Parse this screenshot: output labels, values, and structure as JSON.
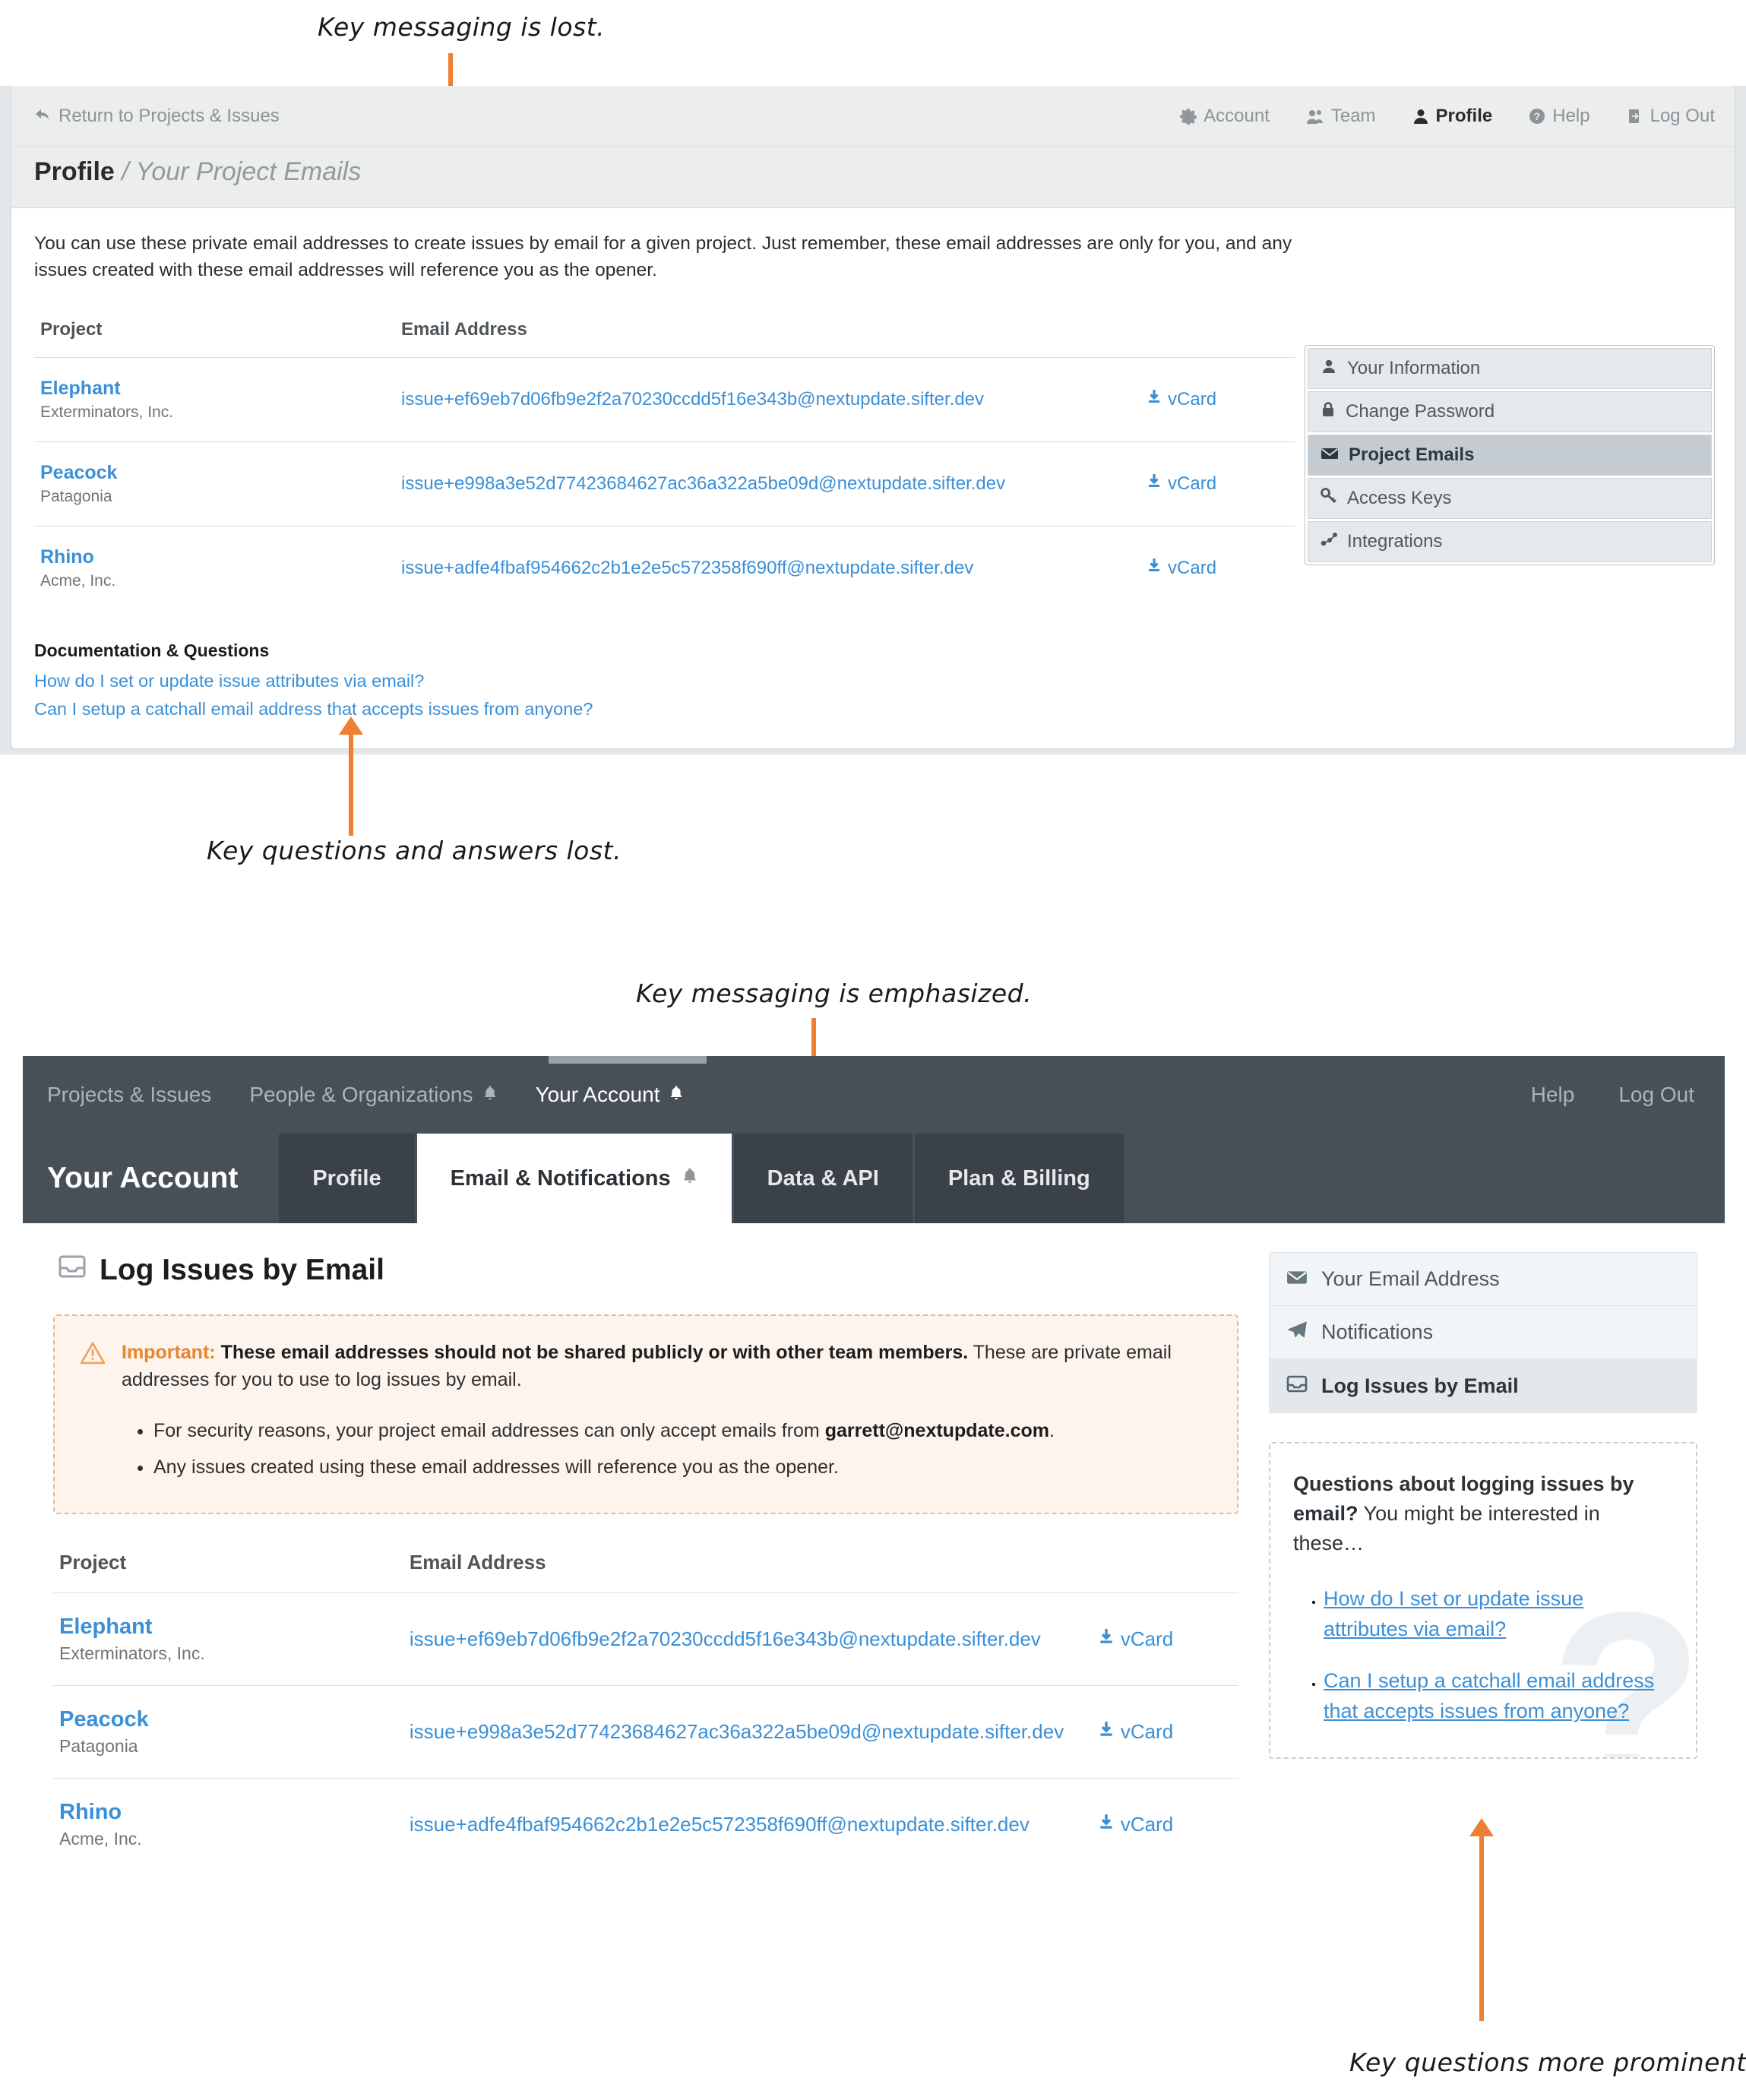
{
  "annotations": [
    {
      "id": "a1",
      "text": "Key messaging is lost."
    },
    {
      "id": "a2",
      "text": "Key questions and answers lost."
    },
    {
      "id": "a3",
      "text": "Key messaging is emphasized."
    },
    {
      "id": "a4",
      "text": "Key questions more prominent."
    }
  ],
  "colors": {
    "accent_orange": "#ef7f33",
    "link_blue": "#3b8fd6",
    "dark_nav": "#474f57",
    "warning_orange": "#e8842c"
  },
  "old_design": {
    "return_link": "Return to Projects & Issues",
    "nav": [
      {
        "label": "Account",
        "icon": "gear-icon",
        "active": false
      },
      {
        "label": "Team",
        "icon": "people-icon",
        "active": false
      },
      {
        "label": "Profile",
        "icon": "person-icon",
        "active": true
      },
      {
        "label": "Help",
        "icon": "question-circle-icon",
        "active": false
      },
      {
        "label": "Log Out",
        "icon": "logout-icon",
        "active": false
      }
    ],
    "title_main": "Profile",
    "title_sep": " / ",
    "title_sub": "Your Project Emails",
    "intro": "You can use these private email addresses to create issues by email for a given project. Just remember, these email addresses are only for you, and any issues created with these email addresses will reference you as the opener.",
    "table": {
      "headers": [
        "Project",
        "Email Address"
      ],
      "vcard_label": "vCard",
      "rows": [
        {
          "project": "Elephant",
          "org": "Exterminators, Inc.",
          "email": "issue+ef69eb7d06fb9e2f2a70230ccdd5f16e343b@nextupdate.sifter.dev"
        },
        {
          "project": "Peacock",
          "org": "Patagonia",
          "email": "issue+e998a3e52d77423684627ac36a322a5be09d@nextupdate.sifter.dev"
        },
        {
          "project": "Rhino",
          "org": "Acme, Inc.",
          "email": "issue+adfe4fbaf954662c2b1e2e5c572358f690ff@nextupdate.sifter.dev"
        }
      ]
    },
    "docs": {
      "heading": "Documentation & Questions",
      "links": [
        "How do I set or update issue attributes via email?",
        "Can I setup a catchall email address that accepts issues from anyone?"
      ]
    },
    "sidebar": [
      {
        "label": "Your Information",
        "icon": "person-icon",
        "active": false
      },
      {
        "label": "Change Password",
        "icon": "lock-icon",
        "active": false
      },
      {
        "label": "Project Emails",
        "icon": "envelope-icon",
        "active": true
      },
      {
        "label": "Access Keys",
        "icon": "key-icon",
        "active": false
      },
      {
        "label": "Integrations",
        "icon": "share-nodes-icon",
        "active": false
      }
    ]
  },
  "new_design": {
    "topnav_left": [
      {
        "label": "Projects & Issues",
        "bell": false,
        "active": false
      },
      {
        "label": "People & Organizations",
        "bell": true,
        "active": false
      },
      {
        "label": "Your Account",
        "bell": true,
        "active": true
      }
    ],
    "topnav_right": [
      {
        "label": "Help"
      },
      {
        "label": "Log Out"
      }
    ],
    "account_title": "Your Account",
    "tabs": [
      {
        "label": "Profile",
        "bell": false,
        "active": false
      },
      {
        "label": "Email & Notifications",
        "bell": true,
        "active": true
      },
      {
        "label": "Data & API",
        "bell": false,
        "active": false
      },
      {
        "label": "Plan & Billing",
        "bell": false,
        "active": false
      }
    ],
    "page_title": "Log Issues by Email",
    "page_title_icon": "inbox-icon",
    "important": {
      "icon": "warning-triangle-icon",
      "label": "Important:",
      "bold_part": "These email addresses should not be shared publicly or with other team members.",
      "rest": " These are private email addresses for you to use to log issues by email.",
      "bullets": [
        {
          "pre": "For security reasons, your project email addresses can only accept emails from ",
          "bold": "garrett@nextupdate.com",
          "post": "."
        },
        {
          "pre": "Any issues created using these email addresses will reference you as the opener.",
          "bold": "",
          "post": ""
        }
      ]
    },
    "table": {
      "headers": [
        "Project",
        "Email Address"
      ],
      "vcard_label": "vCard",
      "rows": [
        {
          "project": "Elephant",
          "org": "Exterminators, Inc.",
          "email": "issue+ef69eb7d06fb9e2f2a70230ccdd5f16e343b@nextupdate.sifter.dev"
        },
        {
          "project": "Peacock",
          "org": "Patagonia",
          "email": "issue+e998a3e52d77423684627ac36a322a5be09d@nextupdate.sifter.dev"
        },
        {
          "project": "Rhino",
          "org": "Acme, Inc.",
          "email": "issue+adfe4fbaf954662c2b1e2e5c572358f690ff@nextupdate.sifter.dev"
        }
      ]
    },
    "sidebar": [
      {
        "label": "Your Email Address",
        "icon": "envelope-icon",
        "active": false
      },
      {
        "label": "Notifications",
        "icon": "paper-plane-icon",
        "active": false
      },
      {
        "label": "Log Issues by Email",
        "icon": "inbox-icon",
        "active": true
      }
    ],
    "questions_box": {
      "watermark": "?",
      "lead_bold": "Questions about logging issues by email?",
      "lead_rest": " You might be interested in these…",
      "links": [
        "How do I set or update issue attributes via email?",
        "Can I setup a catchall email address that accepts issues from anyone?"
      ]
    }
  }
}
